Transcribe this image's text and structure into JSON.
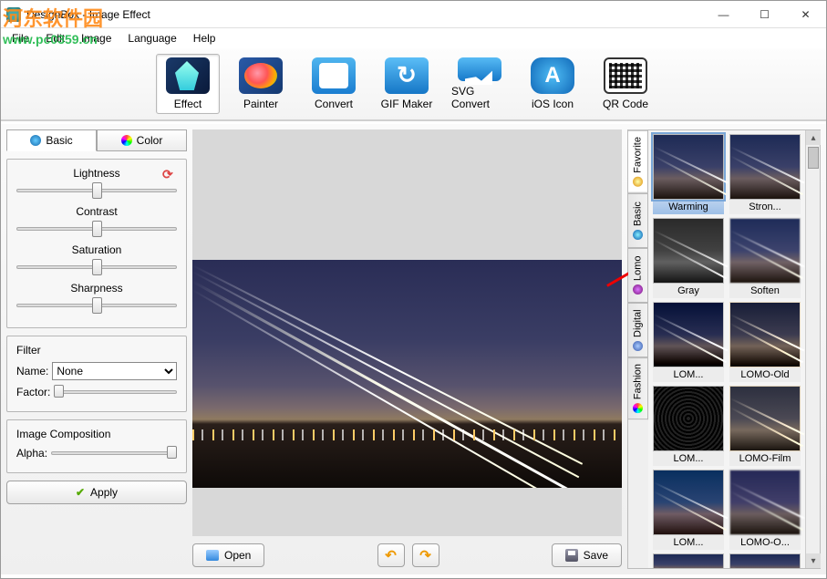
{
  "window": {
    "title": "DesignBox - Image Effect"
  },
  "menu": {
    "file": "File",
    "edit": "Edit",
    "image": "Image",
    "language": "Language",
    "help": "Help"
  },
  "watermark": {
    "text": "河东软件园",
    "url": "www.pc0359.cn"
  },
  "toolbar": {
    "effect": "Effect",
    "painter": "Painter",
    "convert": "Convert",
    "gif": "GIF Maker",
    "svg": "SVG Convert",
    "ios": "iOS Icon",
    "qr": "QR Code"
  },
  "left": {
    "tab_basic": "Basic",
    "tab_color": "Color",
    "lightness": "Lightness",
    "contrast": "Contrast",
    "saturation": "Saturation",
    "sharpness": "Sharpness",
    "filter_title": "Filter",
    "name_label": "Name:",
    "name_value": "None",
    "factor_label": "Factor:",
    "comp_title": "Image Composition",
    "alpha_label": "Alpha:",
    "apply": "Apply"
  },
  "bottom": {
    "open": "Open",
    "save": "Save"
  },
  "right": {
    "vtabs": {
      "favorite": "Favorite",
      "basic": "Basic",
      "lomo": "Lomo",
      "digital": "Digital",
      "fashion": "Fashion"
    },
    "items": [
      {
        "label": "Warming",
        "cls": "selected",
        "lbl": "selbg"
      },
      {
        "label": "Stron...",
        "cls": "",
        "lbl": ""
      },
      {
        "label": "Gray",
        "cls": "gray",
        "lbl": ""
      },
      {
        "label": "Soften",
        "cls": "soft",
        "lbl": ""
      },
      {
        "label": "LOM...",
        "cls": "lomo1",
        "lbl": ""
      },
      {
        "label": "LOMO-Old",
        "cls": "lomo2",
        "lbl": ""
      },
      {
        "label": "LOM...",
        "cls": "noise",
        "lbl": ""
      },
      {
        "label": "LOMO-Film",
        "cls": "film",
        "lbl": ""
      },
      {
        "label": "LOM...",
        "cls": "blueA",
        "lbl": ""
      },
      {
        "label": "LOMO-O...",
        "cls": "blueB",
        "lbl": ""
      }
    ]
  }
}
